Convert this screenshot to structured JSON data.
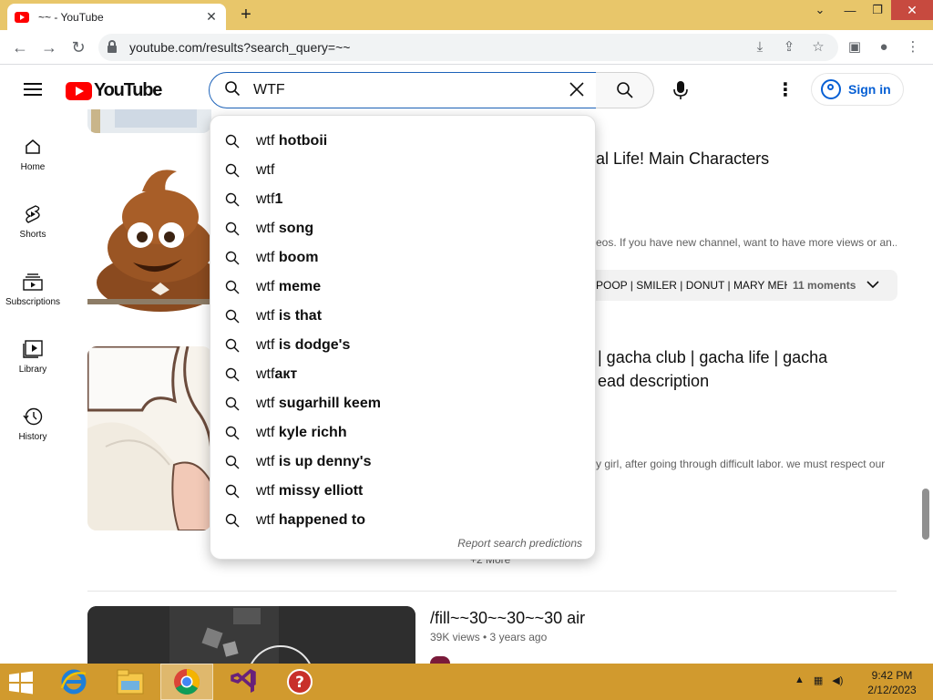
{
  "browser": {
    "tab_title": "~~ - YouTube",
    "url": "youtube.com/results?search_query=~~"
  },
  "youtube": {
    "logo_text": "YouTube",
    "search_value": "WTF",
    "sign_in": "Sign in"
  },
  "sidenav": [
    {
      "label": "Home",
      "icon": "home-icon"
    },
    {
      "label": "Shorts",
      "icon": "shorts-icon"
    },
    {
      "label": "Subscriptions",
      "icon": "subscriptions-icon"
    },
    {
      "label": "Library",
      "icon": "library-icon"
    },
    {
      "label": "History",
      "icon": "history-icon"
    }
  ],
  "results": {
    "r1_title_partial": "al Life! Main Characters",
    "r1_desc_partial": "eos. If you have new channel, want to have more views or an...",
    "r1_chips": "POOP | SMILER | DONUT | MARY MEH...",
    "r1_moments": "11 moments",
    "r2_title_line1": "| gacha club | gacha life | gacha",
    "r2_title_line2": "ead description",
    "r2_desc_partial": "y girl, after going through difficult labor. we must respect our",
    "r2_more": "+2 More",
    "r3_title": "/fill~~30~~30~~30 air",
    "r3_meta": "39K views • 3 years ago"
  },
  "suggestions": [
    {
      "prefix": "wtf",
      "rest": " hotboii"
    },
    {
      "prefix": "wtf",
      "rest": ""
    },
    {
      "prefix": "wtf",
      "rest": "1"
    },
    {
      "prefix": "wtf",
      "rest": " song"
    },
    {
      "prefix": "wtf",
      "rest": " boom"
    },
    {
      "prefix": "wtf",
      "rest": " meme"
    },
    {
      "prefix": "wtf",
      "rest": " is that"
    },
    {
      "prefix": "wtf",
      "rest": " is dodge's"
    },
    {
      "prefix": "wtf",
      "rest": "акт"
    },
    {
      "prefix": "wtf",
      "rest": " sugarhill keem"
    },
    {
      "prefix": "wtf",
      "rest": " kyle richh"
    },
    {
      "prefix": "wtf",
      "rest": " is up denny's"
    },
    {
      "prefix": "wtf",
      "rest": " missy elliott"
    },
    {
      "prefix": "wtf",
      "rest": " happened to"
    }
  ],
  "report_text": "Report search predictions",
  "taskbar": {
    "time": "9:42 PM",
    "date": "2/12/2023"
  },
  "colors": {
    "taskbar": "#d19a2e",
    "tabbar": "#e8c66a",
    "yt_red": "#ff0000",
    "link_blue": "#065fd4"
  }
}
